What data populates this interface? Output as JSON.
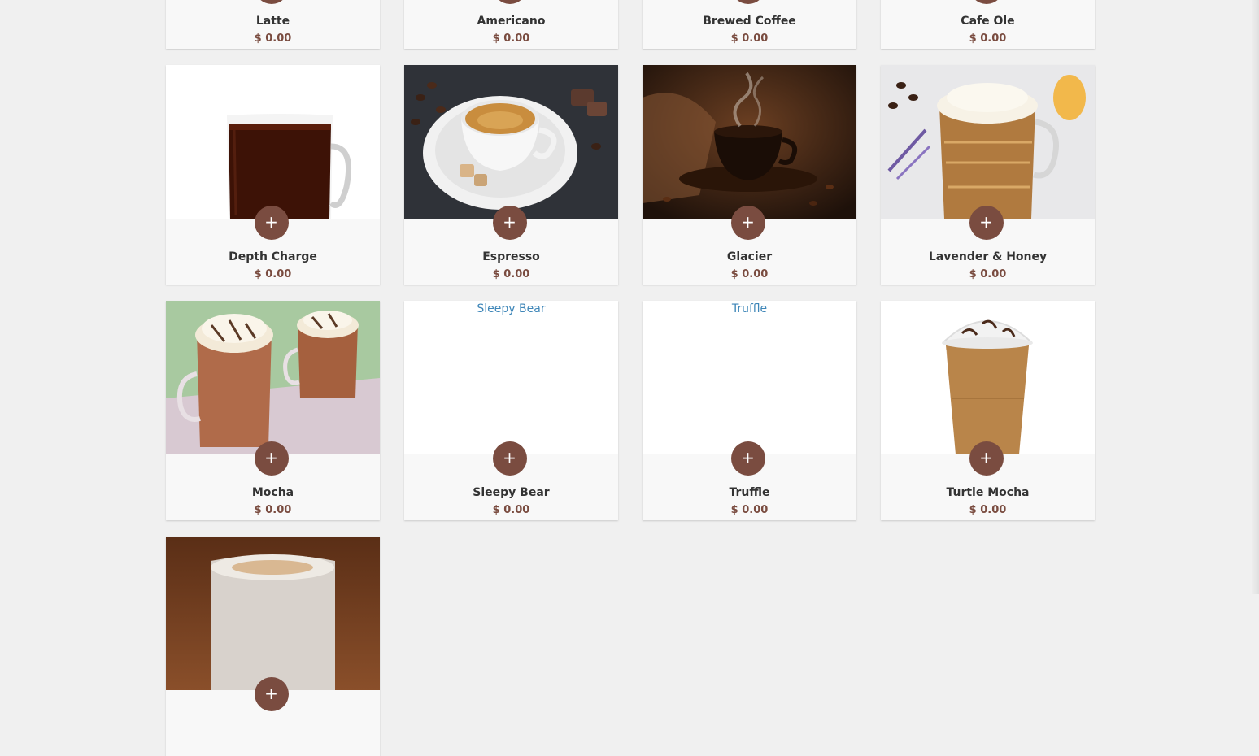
{
  "menu": {
    "add_label": "+",
    "items": [
      {
        "name": "Latte",
        "price": "$ 0.00"
      },
      {
        "name": "Americano",
        "price": "$ 0.00"
      },
      {
        "name": "Brewed Coffee",
        "price": "$ 0.00"
      },
      {
        "name": "Cafe Ole",
        "price": "$ 0.00"
      },
      {
        "name": "Depth Charge",
        "price": "$ 0.00"
      },
      {
        "name": "Espresso",
        "price": "$ 0.00"
      },
      {
        "name": "Glacier",
        "price": "$ 0.00"
      },
      {
        "name": "Lavender & Honey",
        "price": "$ 0.00"
      },
      {
        "name": "Mocha",
        "price": "$ 0.00"
      },
      {
        "name": "Sleepy Bear",
        "price": "$ 0.00",
        "image_alt": "Sleepy Bear"
      },
      {
        "name": "Truffle",
        "price": "$ 0.00",
        "image_alt": "Truffle"
      },
      {
        "name": "Turtle Mocha",
        "price": "$ 0.00"
      },
      {
        "name": "",
        "price": ""
      }
    ]
  },
  "colors": {
    "background": "#f0f0f0",
    "card": "#f8f8f8",
    "accent": "#7a4c40",
    "alt_text": "#3e86b8"
  }
}
